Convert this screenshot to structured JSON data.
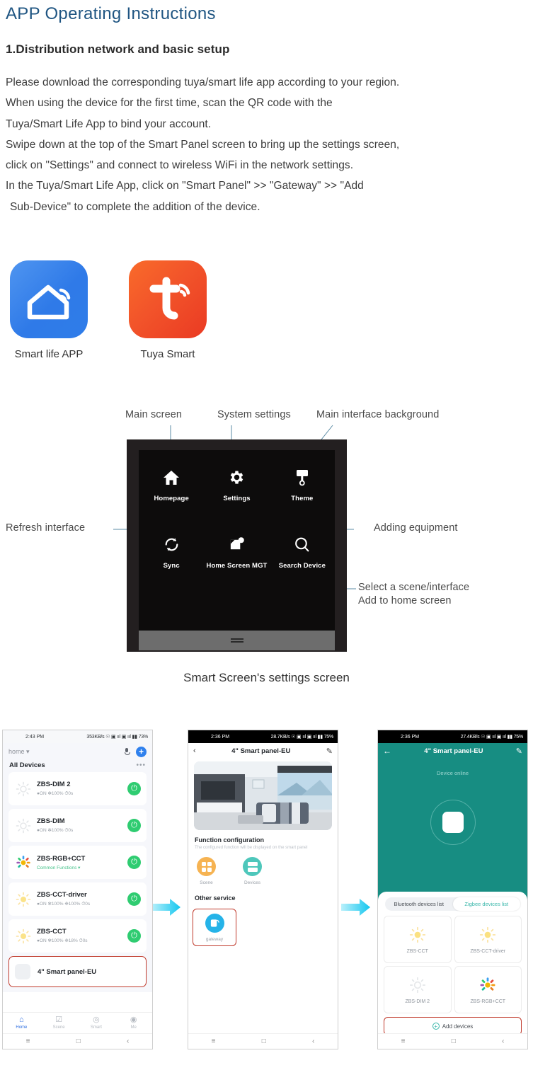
{
  "document": {
    "title": "APP Operating Instructions",
    "section_heading": "1.Distribution network and basic setup",
    "paragraph_lines": [
      "Please download the corresponding tuya/smart life app according to your region.",
      "When using the device for the first time, scan the QR code with the",
      "Tuya/Smart Life App to bind your account.",
      "Swipe down at the top of the Smart Panel screen to bring up the settings screen,",
      "click on \"Settings\" and connect to wireless WiFi in the network settings.",
      "In the Tuya/Smart Life App, click on \"Smart Panel\" >> \"Gateway\" >> \"Add",
      " Sub-Device\" to complete the addition of the device."
    ],
    "title_color": "#1f5582"
  },
  "apps": [
    {
      "name": "Smart life APP",
      "icon": "home-wifi-icon",
      "color": "#2f7ae8"
    },
    {
      "name": "Tuya Smart",
      "icon": "tuya-t-icon",
      "color": "#f2542a"
    }
  ],
  "diagram": {
    "caption": "Smart Screen's settings screen",
    "callouts": [
      {
        "id": "main-screen",
        "text": "Main screen"
      },
      {
        "id": "system-settings",
        "text": "System settings"
      },
      {
        "id": "main-interface-background",
        "text": "Main interface background"
      },
      {
        "id": "refresh-interface",
        "text": "Refresh interface"
      },
      {
        "id": "adding-equipment",
        "text": "Adding equipment"
      },
      {
        "id": "select-scene",
        "line1": "Select a scene/interface",
        "line2": "Add to home screen"
      }
    ],
    "screen_items": [
      {
        "label": "Homepage",
        "icon": "home-icon"
      },
      {
        "label": "Settings",
        "icon": "gear-icon"
      },
      {
        "label": "Theme",
        "icon": "paint-roller-icon"
      },
      {
        "label": "Sync",
        "icon": "refresh-icon"
      },
      {
        "label": "Home Screen MGT",
        "icon": "screen-mgt-icon"
      },
      {
        "label": "Search Device",
        "icon": "search-icon"
      }
    ],
    "line_color": "#5b8ba4"
  },
  "phones": {
    "phone1": {
      "status_time": "2:43 PM",
      "status_right": "353KB/s ☉ ▣ ııl ▣ ııl ▮▮ 73%",
      "home_label": "home",
      "mic_icon": "microphone-icon",
      "add_icon": "plus-icon",
      "section_title": "All Devices",
      "more_icon": "ellipsis-icon",
      "devices": [
        {
          "name": "ZBS-DIM 2",
          "status": "●ON  ✻100%  ⏱0s",
          "icon": "dim-light-icon",
          "toggle": "power-on"
        },
        {
          "name": "ZBS-DIM",
          "status": "●ON  ✻100%  ⏱0s",
          "icon": "dim-light-icon",
          "toggle": "power-on"
        },
        {
          "name": "ZBS-RGB+CCT",
          "status": "Common Functions ▾",
          "status_green": true,
          "icon": "rgb-light-icon",
          "toggle": "power-on"
        },
        {
          "name": "ZBS-CCT-driver",
          "status": "●ON  ✻100%  ❉100%  ⏱0s",
          "icon": "cct-light-icon",
          "toggle": "power-on"
        },
        {
          "name": "ZBS-CCT",
          "status": "●ON  ✻100%  ❉18%  ⏱0s",
          "icon": "cct-light-icon",
          "toggle": "power-on"
        }
      ],
      "highlighted_device": "4\" Smart panel-EU",
      "nav": [
        {
          "label": "Home",
          "icon": "home-icon",
          "active": true
        },
        {
          "label": "Scene",
          "icon": "scene-icon",
          "active": false
        },
        {
          "label": "Smart",
          "icon": "smart-icon",
          "active": false
        },
        {
          "label": "Me",
          "icon": "profile-icon",
          "active": false
        }
      ]
    },
    "phone2": {
      "status_time": "2:36 PM",
      "status_right": "28.7KB/s ☉ ▣ ııl ▣ ııl ▮▮ 75%",
      "back_icon": "chevron-left-icon",
      "title": "4\" Smart panel-EU",
      "edit_icon": "pencil-icon",
      "section_title": "Function configuration",
      "section_sub": "The configured function will be displayed on the smart panel",
      "functions": [
        {
          "label": "Scene",
          "icon": "grid-icon",
          "color": "#f6b352"
        },
        {
          "label": "Devices",
          "icon": "list-icon",
          "color": "#4ec7bb"
        }
      ],
      "other_service_title": "Other service",
      "gateway_label": "gateway",
      "gateway_icon": "gateway-icon",
      "highlight_color": "#c0392b"
    },
    "phone3": {
      "status_time": "2:36 PM",
      "status_right": "27.4KB/s ☉ ▣ ııl ▣ ııl ▮▮ 75%",
      "back_icon": "arrow-left-icon",
      "title": "4\" Smart panel-EU",
      "edit_icon": "pencil-icon",
      "device_status": "Device online",
      "accent_color": "#178d82",
      "tabs": [
        {
          "label": "Bluetooth devices list",
          "selected": false
        },
        {
          "label": "Zigbee devices list",
          "selected": true
        }
      ],
      "devices": [
        {
          "name": "ZBS-CCT",
          "icon": "cct-light-icon"
        },
        {
          "name": "ZBS-CCT-driver",
          "icon": "cct-light-icon"
        },
        {
          "name": "ZBS-DIM 2",
          "icon": "dim-light-icon"
        },
        {
          "name": "ZBS-RGB+CCT",
          "icon": "rgb-light-icon"
        }
      ],
      "add_button": "Add devices",
      "add_icon": "plus-circle-icon"
    },
    "android_nav": {
      "menu": "≡",
      "home": "□",
      "back": "‹"
    }
  }
}
